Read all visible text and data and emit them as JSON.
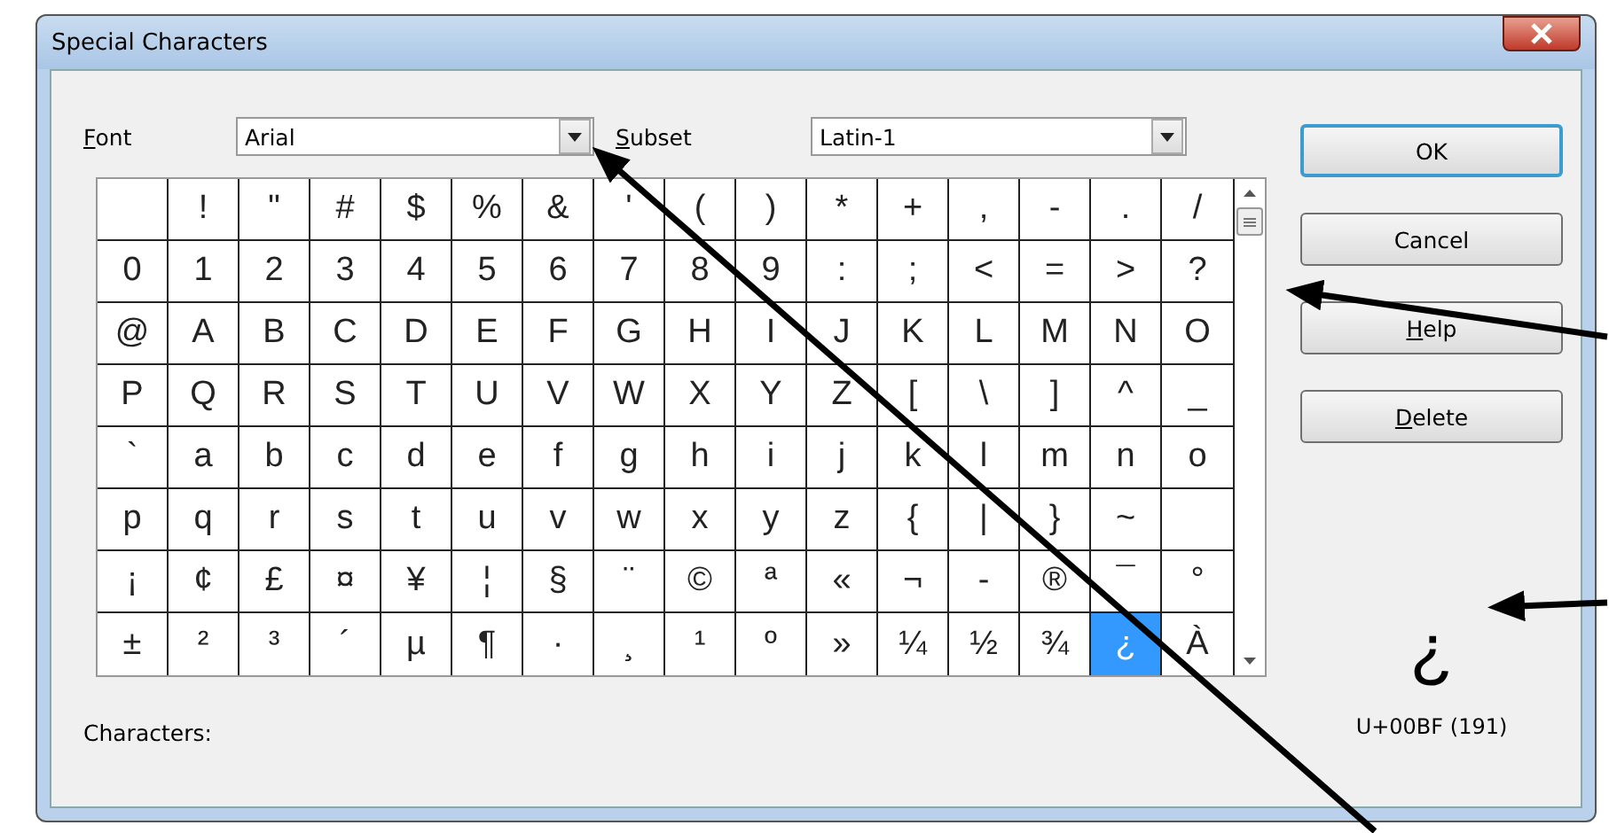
{
  "window": {
    "title": "Special Characters"
  },
  "font": {
    "label": "Font",
    "mnemonic": true,
    "value": "Arial"
  },
  "subset": {
    "label": "Subset",
    "mnemonic": true,
    "value": "Latin-1"
  },
  "grid": {
    "rows": [
      [
        {
          "selected": false
        },
        {
          "char": "!",
          "selected": false
        },
        {
          "char": "\"",
          "selected": false
        },
        {
          "char": "#",
          "selected": false
        },
        {
          "char": "$",
          "selected": false
        },
        {
          "char": "%",
          "selected": false
        },
        {
          "char": "&",
          "selected": false
        },
        {
          "char": "'",
          "selected": false
        },
        {
          "char": "(",
          "selected": false
        },
        {
          "char": ")",
          "selected": false
        },
        {
          "char": "*",
          "selected": false
        },
        {
          "char": "+",
          "selected": false
        },
        {
          "char": ",",
          "selected": false
        },
        {
          "char": "-",
          "selected": false
        },
        {
          "char": ".",
          "selected": false
        },
        {
          "char": "/",
          "selected": false
        }
      ],
      [
        {
          "char": "0",
          "selected": false
        },
        {
          "char": "1",
          "selected": false
        },
        {
          "char": "2",
          "selected": false
        },
        {
          "char": "3",
          "selected": false
        },
        {
          "char": "4",
          "selected": false
        },
        {
          "char": "5",
          "selected": false
        },
        {
          "char": "6",
          "selected": false
        },
        {
          "char": "7",
          "selected": false
        },
        {
          "char": "8",
          "selected": false
        },
        {
          "char": "9",
          "selected": false
        },
        {
          "char": ":",
          "selected": false
        },
        {
          "char": ";",
          "selected": false
        },
        {
          "char": "<",
          "selected": false
        },
        {
          "char": "=",
          "selected": false
        },
        {
          "char": ">",
          "selected": false
        },
        {
          "char": "?",
          "selected": false
        }
      ],
      [
        {
          "char": "@",
          "selected": false
        },
        {
          "char": "A",
          "selected": false
        },
        {
          "char": "B",
          "selected": false
        },
        {
          "char": "C",
          "selected": false
        },
        {
          "char": "D",
          "selected": false
        },
        {
          "char": "E",
          "selected": false
        },
        {
          "char": "F",
          "selected": false
        },
        {
          "char": "G",
          "selected": false
        },
        {
          "char": "H",
          "selected": false
        },
        {
          "char": "I",
          "selected": false
        },
        {
          "char": "J",
          "selected": false
        },
        {
          "char": "K",
          "selected": false
        },
        {
          "char": "L",
          "selected": false
        },
        {
          "char": "M",
          "selected": false
        },
        {
          "char": "N",
          "selected": false
        },
        {
          "char": "O",
          "selected": false
        }
      ],
      [
        {
          "char": "P",
          "selected": false
        },
        {
          "char": "Q",
          "selected": false
        },
        {
          "char": "R",
          "selected": false
        },
        {
          "char": "S",
          "selected": false
        },
        {
          "char": "T",
          "selected": false
        },
        {
          "char": "U",
          "selected": false
        },
        {
          "char": "V",
          "selected": false
        },
        {
          "char": "W",
          "selected": false
        },
        {
          "char": "X",
          "selected": false
        },
        {
          "char": "Y",
          "selected": false
        },
        {
          "char": "Z",
          "selected": false
        },
        {
          "char": "[",
          "selected": false
        },
        {
          "char": "\\",
          "selected": false
        },
        {
          "char": "]",
          "selected": false
        },
        {
          "char": "^",
          "selected": false
        },
        {
          "char": "_",
          "selected": false
        }
      ],
      [
        {
          "char": "`",
          "selected": false
        },
        {
          "char": "a",
          "selected": false
        },
        {
          "char": "b",
          "selected": false
        },
        {
          "char": "c",
          "selected": false
        },
        {
          "char": "d",
          "selected": false
        },
        {
          "char": "e",
          "selected": false
        },
        {
          "char": "f",
          "selected": false
        },
        {
          "char": "g",
          "selected": false
        },
        {
          "char": "h",
          "selected": false
        },
        {
          "char": "i",
          "selected": false
        },
        {
          "char": "j",
          "selected": false
        },
        {
          "char": "k",
          "selected": false
        },
        {
          "char": "l",
          "selected": false
        },
        {
          "char": "m",
          "selected": false
        },
        {
          "char": "n",
          "selected": false
        },
        {
          "char": "o",
          "selected": false
        }
      ],
      [
        {
          "char": "p",
          "selected": false
        },
        {
          "char": "q",
          "selected": false
        },
        {
          "char": "r",
          "selected": false
        },
        {
          "char": "s",
          "selected": false
        },
        {
          "char": "t",
          "selected": false
        },
        {
          "char": "u",
          "selected": false
        },
        {
          "char": "v",
          "selected": false
        },
        {
          "char": "w",
          "selected": false
        },
        {
          "char": "x",
          "selected": false
        },
        {
          "char": "y",
          "selected": false
        },
        {
          "char": "z",
          "selected": false
        },
        {
          "char": "{",
          "selected": false
        },
        {
          "char": "|",
          "selected": false
        },
        {
          "char": "}",
          "selected": false
        },
        {
          "char": "~",
          "selected": false
        },
        {
          "selected": false
        }
      ],
      [
        {
          "char": "¡",
          "selected": false
        },
        {
          "char": "¢",
          "selected": false
        },
        {
          "char": "£",
          "selected": false
        },
        {
          "char": "¤",
          "selected": false
        },
        {
          "char": "¥",
          "selected": false
        },
        {
          "char": "¦",
          "selected": false
        },
        {
          "char": "§",
          "selected": false
        },
        {
          "char": "¨",
          "selected": false
        },
        {
          "char": "©",
          "selected": false
        },
        {
          "char": "ª",
          "selected": false
        },
        {
          "char": "«",
          "selected": false
        },
        {
          "char": "¬",
          "selected": false
        },
        {
          "char": "-",
          "selected": false
        },
        {
          "char": "®",
          "selected": false
        },
        {
          "char": "¯",
          "selected": false
        },
        {
          "char": "°",
          "selected": false
        }
      ],
      [
        {
          "char": "±",
          "selected": false
        },
        {
          "char": "²",
          "selected": false
        },
        {
          "char": "³",
          "selected": false
        },
        {
          "char": "´",
          "selected": false
        },
        {
          "char": "µ",
          "selected": false
        },
        {
          "char": "¶",
          "selected": false
        },
        {
          "char": "·",
          "selected": false
        },
        {
          "char": "¸",
          "selected": false
        },
        {
          "char": "¹",
          "selected": false
        },
        {
          "char": "º",
          "selected": false
        },
        {
          "char": "»",
          "selected": false
        },
        {
          "char": "¼",
          "selected": false
        },
        {
          "char": "½",
          "selected": false
        },
        {
          "char": "¾",
          "selected": false
        },
        {
          "char": "¿",
          "selected": true
        },
        {
          "char": "À",
          "selected": false
        }
      ]
    ]
  },
  "buttons": [
    {
      "label": "OK",
      "mnemonic": false,
      "default": true
    },
    {
      "label": "Cancel",
      "mnemonic": false,
      "default": false
    },
    {
      "label": "Help",
      "mnemonic": true,
      "default": false
    },
    {
      "label": "Delete",
      "mnemonic": true,
      "default": false
    }
  ],
  "preview": {
    "char": "¿",
    "code": "U+00BF (191)"
  },
  "characters": {
    "label": "Characters:"
  }
}
